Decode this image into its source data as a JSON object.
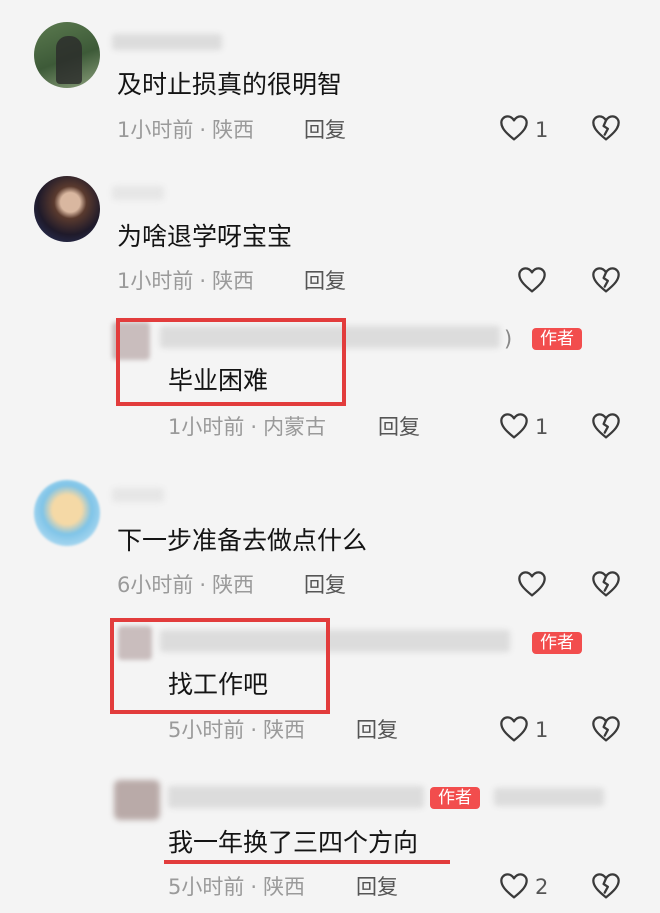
{
  "comments": [
    {
      "text": "及时止损真的很明智",
      "meta": {
        "time": "1小时前",
        "location": "陕西"
      },
      "reply_label": "回复",
      "likes": "1"
    },
    {
      "text": "为啥退学呀宝宝",
      "meta": {
        "time": "1小时前",
        "location": "陕西"
      },
      "reply_label": "回复",
      "author_reply": {
        "paren": ")",
        "badge": "作者",
        "text": "毕业困难",
        "meta": {
          "time": "1小时前",
          "location": "内蒙古"
        },
        "reply_label": "回复",
        "likes": "1"
      }
    },
    {
      "text": "下一步准备去做点什么",
      "meta": {
        "time": "6小时前",
        "location": "陕西"
      },
      "reply_label": "回复",
      "author_reply": {
        "badge": "作者",
        "text": "找工作吧",
        "meta": {
          "time": "5小时前",
          "location": "陕西"
        },
        "reply_label": "回复",
        "likes": "1"
      }
    },
    {
      "badge": "作者",
      "text": "我一年换了三四个方向",
      "meta": {
        "time": "5小时前",
        "location": "陕西"
      },
      "reply_label": "回复",
      "likes": "2"
    }
  ],
  "meta_separator": "·",
  "colors": {
    "accent_red": "#e23c3c",
    "badge_red": "#f24d4d",
    "meta_gray": "#9a9a9a"
  },
  "icons": {
    "like": "heart-outline-icon",
    "dislike": "broken-heart-icon"
  }
}
